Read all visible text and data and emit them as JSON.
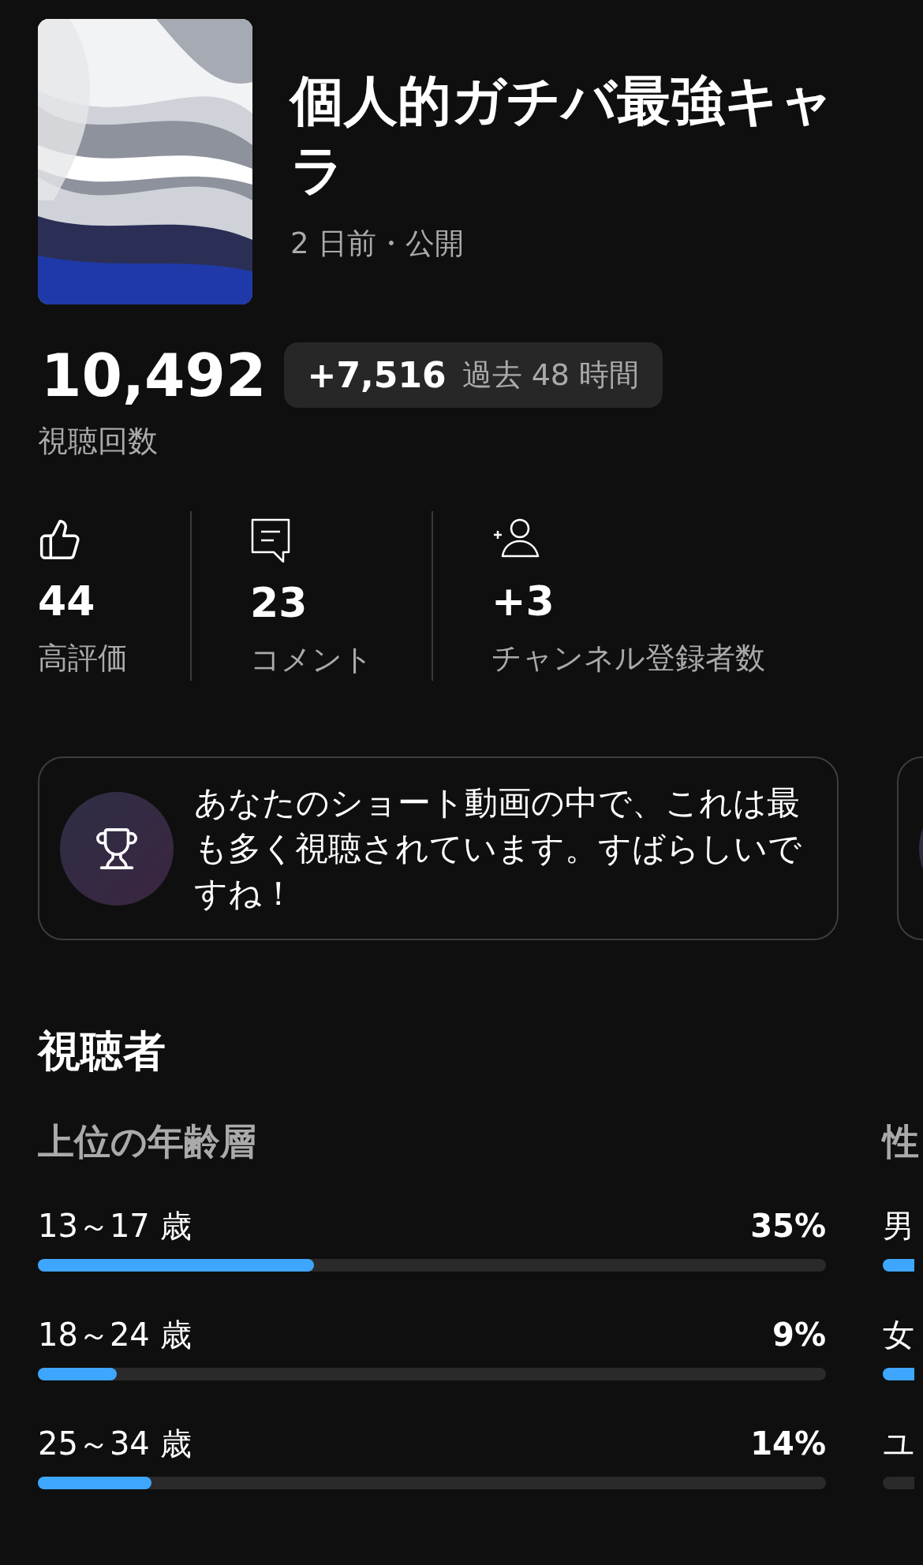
{
  "video": {
    "title": "個人的ガチバ最強キャラ",
    "meta": "2 日前・公開"
  },
  "views": {
    "count": "10,492",
    "label": "視聴回数",
    "delta": "+7,516",
    "delta_period": "過去 48 時間"
  },
  "stats": [
    {
      "kind": "likes",
      "value": "44",
      "label": "高評価"
    },
    {
      "kind": "comments",
      "value": "23",
      "label": "コメント"
    },
    {
      "kind": "subscribers",
      "value": "+3",
      "label": "チャンネル登録者数"
    }
  ],
  "insight_cards": [
    {
      "kind": "message",
      "text": "あなたのショート動画の中で、これは最も多く視聴されています。すばらしいですね！"
    },
    {
      "kind": "partial"
    }
  ],
  "audience": {
    "title": "視聴者",
    "groups": [
      {
        "title": "上位の年齢層",
        "rows": [
          {
            "label": "13～17 歳",
            "reading": "35%",
            "level": 0.35
          },
          {
            "label": "18～24 歳",
            "reading": "9%",
            "level": 0.1
          },
          {
            "label": "25～34 歳",
            "reading": "14%",
            "level": 0.144
          }
        ]
      },
      {
        "title": "性",
        "rows": [
          {
            "label": "男",
            "kind": "filled"
          },
          {
            "label": "女",
            "kind": "filled"
          },
          {
            "label": "ユ",
            "kind": "empty"
          }
        ]
      }
    ]
  }
}
